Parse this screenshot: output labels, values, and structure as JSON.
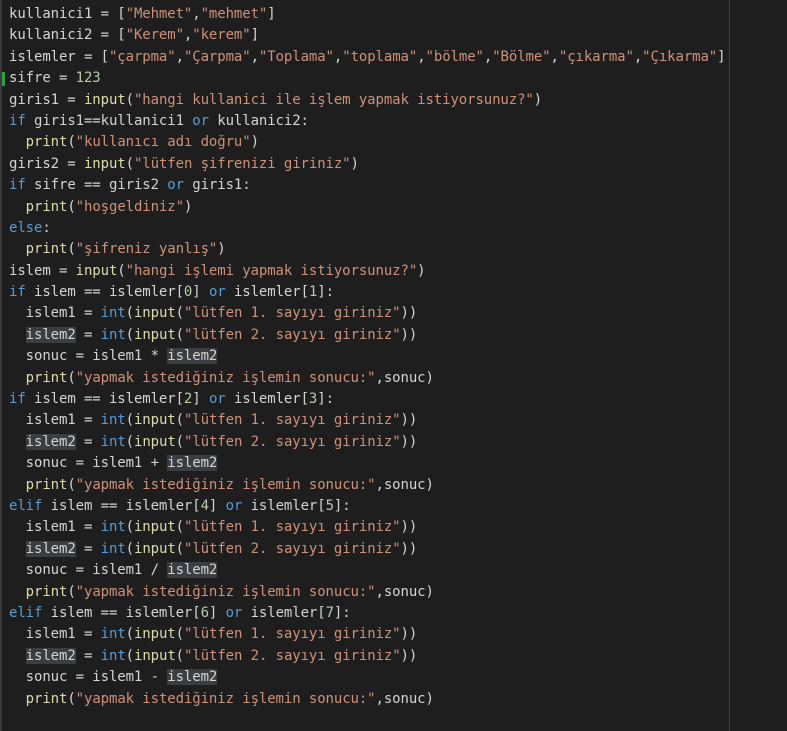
{
  "editor": {
    "language": "python",
    "colors": {
      "background": "#1e1e1e",
      "default": "#d4d4d4",
      "keyword": "#569cd6",
      "string": "#ce9178",
      "number": "#b5cea8",
      "function": "#dcdcaa",
      "highlight": "#3a3d41",
      "git_added": "#2ea043"
    },
    "lines": [
      [
        {
          "t": "kullanici1 = ["
        },
        {
          "t": "\"Mehmet\"",
          "c": "str"
        },
        {
          "t": ","
        },
        {
          "t": "\"mehmet\"",
          "c": "str"
        },
        {
          "t": "]"
        }
      ],
      [
        {
          "t": "kullanici2 = ["
        },
        {
          "t": "\"Kerem\"",
          "c": "str"
        },
        {
          "t": ","
        },
        {
          "t": "\"kerem\"",
          "c": "str"
        },
        {
          "t": "]"
        }
      ],
      [
        {
          "t": "islemler = ["
        },
        {
          "t": "\"çarpma\"",
          "c": "str"
        },
        {
          "t": ","
        },
        {
          "t": "\"Çarpma\"",
          "c": "str"
        },
        {
          "t": ","
        },
        {
          "t": "\"Toplama\"",
          "c": "str"
        },
        {
          "t": ","
        },
        {
          "t": "\"toplama\"",
          "c": "str"
        },
        {
          "t": ","
        },
        {
          "t": "\"bölme\"",
          "c": "str"
        },
        {
          "t": ","
        },
        {
          "t": "\"Bölme\"",
          "c": "str"
        },
        {
          "t": ","
        },
        {
          "t": "\"çıkarma\"",
          "c": "str"
        },
        {
          "t": ","
        },
        {
          "t": "\"Çıkarma\"",
          "c": "str"
        },
        {
          "t": "]"
        }
      ],
      [
        {
          "t": "sifre = "
        },
        {
          "t": "123",
          "c": "num"
        }
      ],
      [
        {
          "t": "giris1 = "
        },
        {
          "t": "input",
          "c": "fn"
        },
        {
          "t": "("
        },
        {
          "t": "\"hangi kullanici ile işlem yapmak istiyorsunuz?\"",
          "c": "str"
        },
        {
          "t": ")"
        }
      ],
      [
        {
          "t": "if",
          "c": "kw"
        },
        {
          "t": " giris1==kullanici1 "
        },
        {
          "t": "or",
          "c": "kw"
        },
        {
          "t": " kullanici2:"
        }
      ],
      [
        {
          "t": "  "
        },
        {
          "t": "print",
          "c": "fn"
        },
        {
          "t": "("
        },
        {
          "t": "\"kullanıcı adı doğru\"",
          "c": "str"
        },
        {
          "t": ")"
        }
      ],
      [
        {
          "t": "giris2 = "
        },
        {
          "t": "input",
          "c": "fn"
        },
        {
          "t": "("
        },
        {
          "t": "\"lütfen şifrenizi giriniz\"",
          "c": "str"
        },
        {
          "t": ")"
        }
      ],
      [
        {
          "t": "if",
          "c": "kw"
        },
        {
          "t": " sifre == giris2 "
        },
        {
          "t": "or",
          "c": "kw"
        },
        {
          "t": " giris1:"
        }
      ],
      [
        {
          "t": "  "
        },
        {
          "t": "print",
          "c": "fn"
        },
        {
          "t": "("
        },
        {
          "t": "\"hoşgeldiniz\"",
          "c": "str"
        },
        {
          "t": ")"
        }
      ],
      [
        {
          "t": "else",
          "c": "kw"
        },
        {
          "t": ":"
        }
      ],
      [
        {
          "t": "  "
        },
        {
          "t": "print",
          "c": "fn"
        },
        {
          "t": "("
        },
        {
          "t": "\"şifreniz yanlış\"",
          "c": "str"
        },
        {
          "t": ")"
        }
      ],
      [
        {
          "t": "islem = "
        },
        {
          "t": "input",
          "c": "fn"
        },
        {
          "t": "("
        },
        {
          "t": "\"hangi işlemi yapmak istiyorsunuz?\"",
          "c": "str"
        },
        {
          "t": ")"
        }
      ],
      [
        {
          "t": "if",
          "c": "kw"
        },
        {
          "t": " islem == islemler["
        },
        {
          "t": "0",
          "c": "num"
        },
        {
          "t": "] "
        },
        {
          "t": "or",
          "c": "kw"
        },
        {
          "t": " islemler["
        },
        {
          "t": "1",
          "c": "num"
        },
        {
          "t": "]:"
        }
      ],
      [
        {
          "t": "  islem1 = "
        },
        {
          "t": "int",
          "c": "kw"
        },
        {
          "t": "("
        },
        {
          "t": "input",
          "c": "fn"
        },
        {
          "t": "("
        },
        {
          "t": "\"lütfen 1. sayıyı giriniz\"",
          "c": "str"
        },
        {
          "t": "))"
        }
      ],
      [
        {
          "t": "  "
        },
        {
          "t": "islem2",
          "c": "hl"
        },
        {
          "t": " = "
        },
        {
          "t": "int",
          "c": "kw"
        },
        {
          "t": "("
        },
        {
          "t": "input",
          "c": "fn"
        },
        {
          "t": "("
        },
        {
          "t": "\"lütfen 2. sayıyı giriniz\"",
          "c": "str"
        },
        {
          "t": "))"
        }
      ],
      [
        {
          "t": "  sonuc = islem1 * "
        },
        {
          "t": "islem2",
          "c": "hl"
        }
      ],
      [
        {
          "t": "  "
        },
        {
          "t": "print",
          "c": "fn"
        },
        {
          "t": "("
        },
        {
          "t": "\"yapmak istediğiniz işlemin sonucu:\"",
          "c": "str"
        },
        {
          "t": ",sonuc)"
        }
      ],
      [
        {
          "t": "if",
          "c": "kw"
        },
        {
          "t": " islem == islemler["
        },
        {
          "t": "2",
          "c": "num"
        },
        {
          "t": "] "
        },
        {
          "t": "or",
          "c": "kw"
        },
        {
          "t": " islemler["
        },
        {
          "t": "3",
          "c": "num"
        },
        {
          "t": "]:"
        }
      ],
      [
        {
          "t": "  islem1 = "
        },
        {
          "t": "int",
          "c": "kw"
        },
        {
          "t": "("
        },
        {
          "t": "input",
          "c": "fn"
        },
        {
          "t": "("
        },
        {
          "t": "\"lütfen 1. sayıyı giriniz\"",
          "c": "str"
        },
        {
          "t": "))"
        }
      ],
      [
        {
          "t": "  "
        },
        {
          "t": "islem2",
          "c": "hl"
        },
        {
          "t": " = "
        },
        {
          "t": "int",
          "c": "kw"
        },
        {
          "t": "("
        },
        {
          "t": "input",
          "c": "fn"
        },
        {
          "t": "("
        },
        {
          "t": "\"lütfen 2. sayıyı giriniz\"",
          "c": "str"
        },
        {
          "t": "))"
        }
      ],
      [
        {
          "t": "  sonuc = islem1 + "
        },
        {
          "t": "islem2",
          "c": "hl"
        }
      ],
      [
        {
          "t": "  "
        },
        {
          "t": "print",
          "c": "fn"
        },
        {
          "t": "("
        },
        {
          "t": "\"yapmak istediğiniz işlemin sonucu:\"",
          "c": "str"
        },
        {
          "t": ",sonuc)"
        }
      ],
      [
        {
          "t": "elif",
          "c": "kw"
        },
        {
          "t": " islem == islemler["
        },
        {
          "t": "4",
          "c": "num"
        },
        {
          "t": "] "
        },
        {
          "t": "or",
          "c": "kw"
        },
        {
          "t": " islemler["
        },
        {
          "t": "5",
          "c": "num"
        },
        {
          "t": "]:"
        }
      ],
      [
        {
          "t": "  islem1 = "
        },
        {
          "t": "int",
          "c": "kw"
        },
        {
          "t": "("
        },
        {
          "t": "input",
          "c": "fn"
        },
        {
          "t": "("
        },
        {
          "t": "\"lütfen 1. sayıyı giriniz\"",
          "c": "str"
        },
        {
          "t": "))"
        }
      ],
      [
        {
          "t": "  "
        },
        {
          "t": "islem2",
          "c": "hl"
        },
        {
          "t": " = "
        },
        {
          "t": "int",
          "c": "kw"
        },
        {
          "t": "("
        },
        {
          "t": "input",
          "c": "fn"
        },
        {
          "t": "("
        },
        {
          "t": "\"lütfen 2. sayıyı giriniz\"",
          "c": "str"
        },
        {
          "t": "))"
        }
      ],
      [
        {
          "t": "  sonuc = islem1 / "
        },
        {
          "t": "islem2",
          "c": "hl"
        }
      ],
      [
        {
          "t": "  "
        },
        {
          "t": "print",
          "c": "fn"
        },
        {
          "t": "("
        },
        {
          "t": "\"yapmak istediğiniz işlemin sonucu:\"",
          "c": "str"
        },
        {
          "t": ",sonuc)"
        }
      ],
      [
        {
          "t": "elif",
          "c": "kw"
        },
        {
          "t": " islem == islemler["
        },
        {
          "t": "6",
          "c": "num"
        },
        {
          "t": "] "
        },
        {
          "t": "or",
          "c": "kw"
        },
        {
          "t": " islemler["
        },
        {
          "t": "7",
          "c": "num"
        },
        {
          "t": "]:"
        }
      ],
      [
        {
          "t": "  islem1 = "
        },
        {
          "t": "int",
          "c": "kw"
        },
        {
          "t": "("
        },
        {
          "t": "input",
          "c": "fn"
        },
        {
          "t": "("
        },
        {
          "t": "\"lütfen 1. sayıyı giriniz\"",
          "c": "str"
        },
        {
          "t": "))"
        }
      ],
      [
        {
          "t": "  "
        },
        {
          "t": "islem2",
          "c": "hl"
        },
        {
          "t": " = "
        },
        {
          "t": "int",
          "c": "kw"
        },
        {
          "t": "("
        },
        {
          "t": "input",
          "c": "fn"
        },
        {
          "t": "("
        },
        {
          "t": "\"lütfen 2. sayıyı giriniz\"",
          "c": "str"
        },
        {
          "t": "))"
        }
      ],
      [
        {
          "t": "  sonuc = islem1 - "
        },
        {
          "t": "islem2",
          "c": "hl"
        }
      ],
      [
        {
          "t": "  "
        },
        {
          "t": "print",
          "c": "fn"
        },
        {
          "t": "("
        },
        {
          "t": "\"yapmak istediğiniz işlemin sonucu:\"",
          "c": "str"
        },
        {
          "t": ",sonuc)"
        }
      ]
    ]
  }
}
